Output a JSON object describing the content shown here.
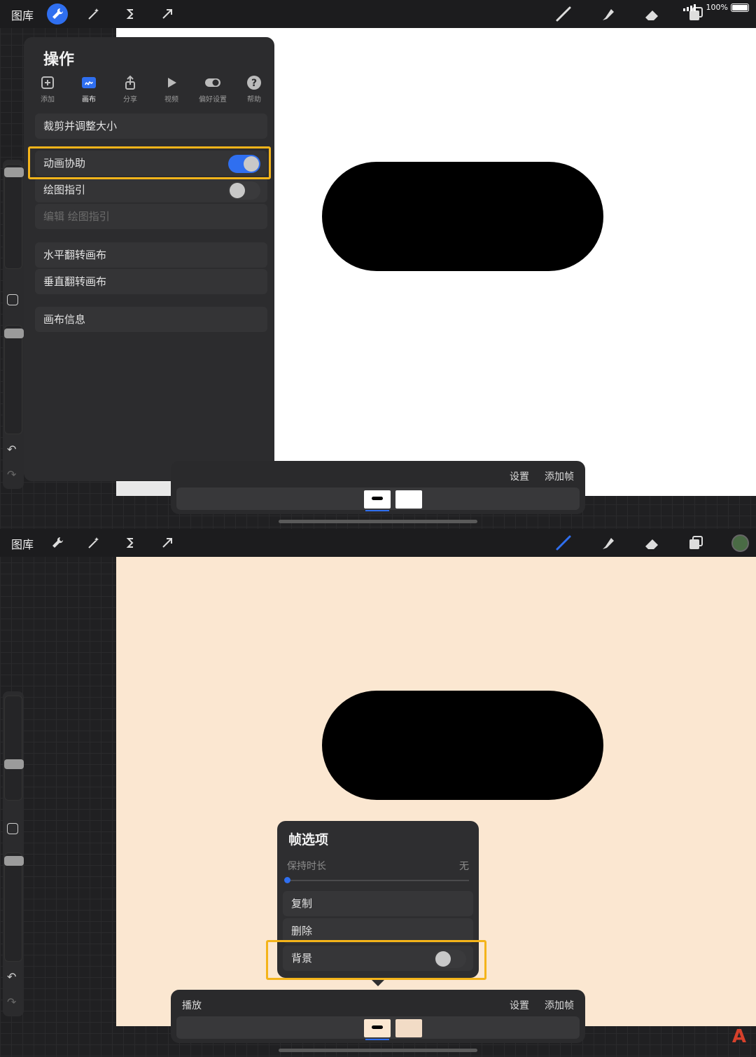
{
  "colors": {
    "accent": "#2f6ff0",
    "highlight": "#f4b41a",
    "canvas_top": "#ffffff",
    "canvas_bottom": "#fbe7d1",
    "shape": "#000000",
    "color_swatch": "#4a6b45",
    "logo": "#d6402b"
  },
  "topbar": {
    "gallery_label": "图库",
    "battery_text": "100%",
    "left_icons": [
      "wrench-icon",
      "magic-wand-icon",
      "selection-s-icon",
      "transform-arrow-icon"
    ],
    "right_icons": [
      "brush-icon",
      "smudge-icon",
      "eraser-icon",
      "layers-icon"
    ]
  },
  "actions_panel": {
    "title": "操作",
    "tabs": [
      {
        "label": "添加",
        "icon": "add-icon"
      },
      {
        "label": "画布",
        "icon": "canvas-icon",
        "active": true
      },
      {
        "label": "分享",
        "icon": "share-icon"
      },
      {
        "label": "视频",
        "icon": "video-icon"
      },
      {
        "label": "偏好设置",
        "icon": "preferences-toggle-icon"
      },
      {
        "label": "帮助",
        "icon": "help-icon"
      }
    ],
    "rows": {
      "crop": "裁剪并调整大小",
      "animation_assist": "动画协助",
      "drawing_guide": "绘图指引",
      "edit_guide": "编辑 绘图指引",
      "flip_h": "水平翻转画布",
      "flip_v": "垂直翻转画布",
      "canvas_info": "画布信息"
    },
    "toggles": {
      "animation_assist": true,
      "drawing_guide": false
    }
  },
  "timeline_top": {
    "settings": "设置",
    "add_frame": "添加帧"
  },
  "timeline_bottom": {
    "play": "播放",
    "settings": "设置",
    "add_frame": "添加帧"
  },
  "frame_options": {
    "title": "帧选项",
    "hold_label": "保持时长",
    "hold_value": "无",
    "hold_level": 0,
    "duplicate": "复制",
    "delete": "删除",
    "background": "背景",
    "background_on": false
  }
}
